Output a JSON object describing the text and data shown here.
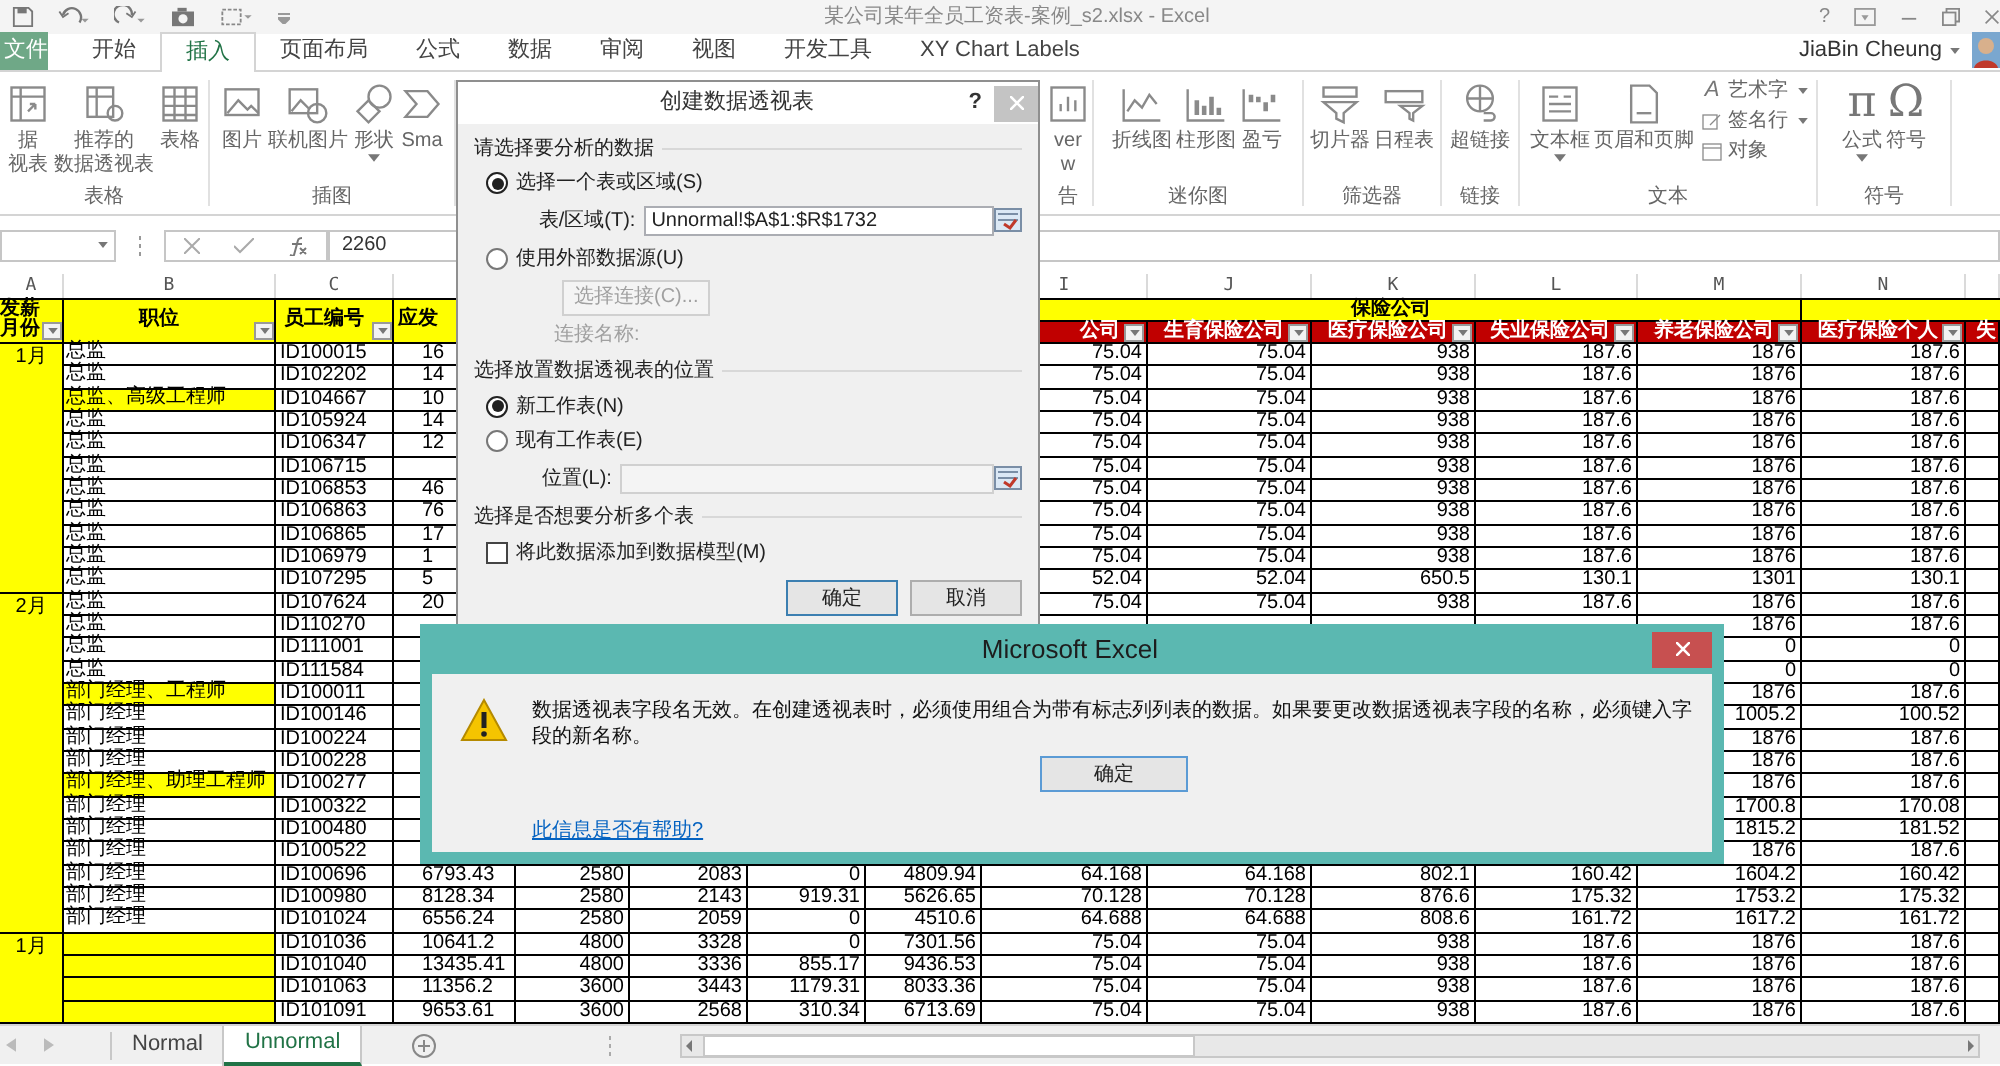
{
  "title_bar": {
    "title": "某公司某年全员工资表-案例_s2.xlsx - Excel",
    "help": "?"
  },
  "tabs": [
    {
      "label": "文件",
      "kind": "file",
      "selected": false
    },
    {
      "label": "开始",
      "kind": "tab",
      "selected": false
    },
    {
      "label": "插入",
      "kind": "tab",
      "selected": true
    },
    {
      "label": "页面布局",
      "kind": "tab",
      "selected": false
    },
    {
      "label": "公式",
      "kind": "tab",
      "selected": false
    },
    {
      "label": "数据",
      "kind": "tab",
      "selected": false
    },
    {
      "label": "审阅",
      "kind": "tab",
      "selected": false
    },
    {
      "label": "视图",
      "kind": "tab",
      "selected": false
    },
    {
      "label": "开发工具",
      "kind": "tab",
      "selected": false
    },
    {
      "label": "XY Chart Labels",
      "kind": "tab",
      "selected": false
    }
  ],
  "user": {
    "name": "JiaBin Cheung"
  },
  "ribbon": {
    "groups": [
      {
        "label": "表格",
        "items": [
          {
            "lines": [
              "据",
              "视表"
            ],
            "dropdown": false
          },
          {
            "lines": [
              "推荐的",
              "数据透视表"
            ],
            "dropdown": false
          },
          {
            "lines": [
              "表格"
            ],
            "dropdown": false
          }
        ]
      },
      {
        "label": "插图",
        "items": [
          {
            "lines": [
              "图片"
            ],
            "dropdown": false
          },
          {
            "lines": [
              "联机图片"
            ],
            "dropdown": false
          },
          {
            "lines": [
              "形状"
            ],
            "dropdown": true
          },
          {
            "lines": [
              "Sma"
            ],
            "dropdown": false
          }
        ]
      },
      {
        "label": "告",
        "items": [
          {
            "lines": [
              "ver",
              "w"
            ],
            "dropdown": false
          }
        ]
      },
      {
        "label": "迷你图",
        "items": [
          {
            "lines": [
              "折线图"
            ],
            "dropdown": false
          },
          {
            "lines": [
              "柱形图"
            ],
            "dropdown": false
          },
          {
            "lines": [
              "盈亏"
            ],
            "dropdown": false
          }
        ]
      },
      {
        "label": "筛选器",
        "items": [
          {
            "lines": [
              "切片器"
            ],
            "dropdown": false
          },
          {
            "lines": [
              "日程表"
            ],
            "dropdown": false
          }
        ]
      },
      {
        "label": "链接",
        "items": [
          {
            "lines": [
              "超链接"
            ],
            "dropdown": false
          }
        ]
      },
      {
        "label": "文本",
        "items": [
          {
            "lines": [
              "文本框"
            ],
            "dropdown": true
          },
          {
            "lines": [
              "页眉和页脚"
            ],
            "dropdown": false
          }
        ],
        "stack": [
          {
            "label": "艺术字",
            "glyph": "A",
            "dropdown": true
          },
          {
            "label": "签名行",
            "dropdown": true
          },
          {
            "label": "对象",
            "dropdown": false
          }
        ]
      },
      {
        "label": "符号",
        "items": [
          {
            "lines": [
              "公式"
            ],
            "glyph": "π",
            "dropdown": true
          },
          {
            "lines": [
              "符号"
            ],
            "glyph": "Ω",
            "dropdown": false
          }
        ]
      }
    ]
  },
  "formula_bar": {
    "value": "2260"
  },
  "sheet": {
    "column_letters": {
      "A": "A",
      "B": "B",
      "C": "C",
      "I": "I",
      "J": "J",
      "K": "K",
      "L": "L",
      "M": "M",
      "N": "N"
    },
    "header": {
      "cells": {
        "A": {
          "text": "发薪月份",
          "filter": true
        },
        "B": {
          "text": "职位",
          "filter": true
        },
        "C": {
          "text": "员工编号",
          "filter": true
        },
        "D": {
          "text": "应发",
          "filter": false
        }
      },
      "band": "保险公司",
      "fields": {
        "I": {
          "text": "公司",
          "filter": true
        },
        "J": {
          "text": "生育保险公司",
          "filter": true
        },
        "K": {
          "text": "医疗保险公司",
          "filter": true
        },
        "L": {
          "text": "失业保险公司",
          "filter": true
        },
        "M": {
          "text": "养老保险公司",
          "filter": true
        },
        "N": {
          "text": "医疗保险个人",
          "filter": true
        },
        "O": {
          "text": "失",
          "filter": false
        }
      }
    },
    "groups": [
      {
        "month": "1月",
        "rows": [
          {
            "id": "ID100015",
            "position": "总监",
            "highlighted": false,
            "cells": {
              "D": "16",
              "I": "75.04",
              "J": "75.04",
              "K": "938",
              "L": "187.6",
              "M": "1876",
              "N": "187.6"
            }
          },
          {
            "id": "ID102202",
            "position": "总监",
            "highlighted": false,
            "cells": {
              "D": "14",
              "I": "75.04",
              "J": "75.04",
              "K": "938",
              "L": "187.6",
              "M": "1876",
              "N": "187.6"
            }
          },
          {
            "id": "ID104667",
            "position": "总监、高级工程师",
            "highlighted": true,
            "cells": {
              "D": "10",
              "I": "75.04",
              "J": "75.04",
              "K": "938",
              "L": "187.6",
              "M": "1876",
              "N": "187.6"
            }
          },
          {
            "id": "ID105924",
            "position": "总监",
            "highlighted": false,
            "cells": {
              "D": "14",
              "I": "75.04",
              "J": "75.04",
              "K": "938",
              "L": "187.6",
              "M": "1876",
              "N": "187.6"
            }
          },
          {
            "id": "ID106347",
            "position": "总监",
            "highlighted": false,
            "cells": {
              "D": "12",
              "I": "75.04",
              "J": "75.04",
              "K": "938",
              "L": "187.6",
              "M": "1876",
              "N": "187.6"
            }
          },
          {
            "id": "ID106715",
            "position": "总监",
            "highlighted": false,
            "cells": {
              "I": "75.04",
              "J": "75.04",
              "K": "938",
              "L": "187.6",
              "M": "1876",
              "N": "187.6"
            }
          },
          {
            "id": "ID106853",
            "position": "总监",
            "highlighted": false,
            "cells": {
              "D": "46",
              "I": "75.04",
              "J": "75.04",
              "K": "938",
              "L": "187.6",
              "M": "1876",
              "N": "187.6"
            }
          },
          {
            "id": "ID106863",
            "position": "总监",
            "highlighted": false,
            "cells": {
              "D": "76",
              "I": "75.04",
              "J": "75.04",
              "K": "938",
              "L": "187.6",
              "M": "1876",
              "N": "187.6"
            }
          },
          {
            "id": "ID106865",
            "position": "总监",
            "highlighted": false,
            "cells": {
              "D": "17",
              "I": "75.04",
              "J": "75.04",
              "K": "938",
              "L": "187.6",
              "M": "1876",
              "N": "187.6"
            }
          },
          {
            "id": "ID106979",
            "position": "总监",
            "highlighted": false,
            "cells": {
              "D": "1",
              "I": "75.04",
              "J": "75.04",
              "K": "938",
              "L": "187.6",
              "M": "1876",
              "N": "187.6"
            }
          },
          {
            "id": "ID107295",
            "position": "总监",
            "highlighted": false,
            "cells": {
              "D": "5",
              "I": "52.04",
              "J": "52.04",
              "K": "650.5",
              "L": "130.1",
              "M": "1301",
              "N": "130.1"
            }
          }
        ]
      },
      {
        "month": "2月",
        "rows": [
          {
            "id": "ID107624",
            "position": "总监",
            "highlighted": false,
            "cells": {
              "D": "20",
              "I": "75.04",
              "J": "75.04",
              "K": "938",
              "L": "187.6",
              "M": "1876",
              "N": "187.6"
            }
          },
          {
            "id": "ID110270",
            "position": "总监",
            "highlighted": false,
            "cells": {
              "M": "1876",
              "N": "187.6"
            }
          },
          {
            "id": "ID111001",
            "position": "总监",
            "highlighted": false,
            "cells": {
              "M": "0",
              "N": "0"
            }
          },
          {
            "id": "ID111584",
            "position": "总监",
            "highlighted": false,
            "cells": {
              "M": "0",
              "N": "0"
            }
          },
          {
            "id": "ID100011",
            "position": "部门经理、工程师",
            "highlighted": true,
            "cells": {
              "M": "1876",
              "N": "187.6"
            }
          },
          {
            "id": "ID100146",
            "position": "部门经理",
            "highlighted": false,
            "cells": {
              "M": "1005.2",
              "N": "100.52"
            }
          },
          {
            "id": "ID100224",
            "position": "部门经理",
            "highlighted": false,
            "cells": {
              "M": "1876",
              "N": "187.6"
            }
          },
          {
            "id": "ID100228",
            "position": "部门经理",
            "highlighted": false,
            "cells": {
              "M": "1876",
              "N": "187.6"
            }
          },
          {
            "id": "ID100277",
            "position": "部门经理、助理工程师",
            "highlighted": true,
            "cells": {
              "M": "1876",
              "N": "187.6"
            }
          },
          {
            "id": "ID100322",
            "position": "部门经理",
            "highlighted": false,
            "cells": {
              "M": "1700.8",
              "N": "170.08"
            }
          },
          {
            "id": "ID100480",
            "position": "部门经理",
            "highlighted": false,
            "cells": {
              "M": "1815.2",
              "N": "181.52"
            }
          },
          {
            "id": "ID100522",
            "position": "部门经理",
            "highlighted": false,
            "cells": {
              "M": "1876",
              "N": "187.6"
            }
          },
          {
            "id": "ID100696",
            "position": "部门经理",
            "highlighted": false,
            "cells": {
              "D": "6793.43",
              "E": "2580",
              "F": "2083",
              "G": "0",
              "H": "4809.94",
              "I": "64.168",
              "J": "64.168",
              "K": "802.1",
              "L": "160.42",
              "M": "1604.2",
              "N": "160.42"
            }
          },
          {
            "id": "ID100980",
            "position": "部门经理",
            "highlighted": false,
            "cells": {
              "D": "8128.34",
              "E": "2580",
              "F": "2143",
              "G": "919.31",
              "H": "5626.65",
              "I": "70.128",
              "J": "70.128",
              "K": "876.6",
              "L": "175.32",
              "M": "1753.2",
              "N": "175.32"
            }
          },
          {
            "id": "ID101024",
            "position": "部门经理",
            "highlighted": false,
            "cells": {
              "D": "6556.24",
              "E": "2580",
              "F": "2059",
              "G": "0",
              "H": "4510.6",
              "I": "64.688",
              "J": "64.688",
              "K": "808.6",
              "L": "161.72",
              "M": "1617.2",
              "N": "161.72"
            }
          }
        ]
      },
      {
        "month": "1月",
        "rows": [
          {
            "id": "ID101036",
            "highlighted": true,
            "cells": {
              "D": "10641.2",
              "E": "4800",
              "F": "3328",
              "G": "0",
              "H": "7301.56",
              "I": "75.04",
              "J": "75.04",
              "K": "938",
              "L": "187.6",
              "M": "1876",
              "N": "187.6"
            }
          },
          {
            "id": "ID101040",
            "highlighted": true,
            "cells": {
              "D": "13435.41",
              "E": "4800",
              "F": "3336",
              "G": "855.17",
              "H": "9436.53",
              "I": "75.04",
              "J": "75.04",
              "K": "938",
              "L": "187.6",
              "M": "1876",
              "N": "187.6"
            }
          },
          {
            "id": "ID101063",
            "highlighted": true,
            "cells": {
              "D": "11356.2",
              "E": "3600",
              "F": "3443",
              "G": "1179.31",
              "H": "8033.36",
              "I": "75.04",
              "J": "75.04",
              "K": "938",
              "L": "187.6",
              "M": "1876",
              "N": "187.6"
            }
          },
          {
            "id": "ID101091",
            "highlighted": true,
            "cells": {
              "D": "9653.61",
              "E": "3600",
              "F": "2568",
              "G": "310.34",
              "H": "6713.69",
              "I": "75.04",
              "J": "75.04",
              "K": "938",
              "L": "187.6",
              "M": "1876",
              "N": "187.6"
            }
          }
        ]
      }
    ]
  },
  "sheet_tabs": [
    {
      "label": "Normal",
      "selected": false
    },
    {
      "label": "Unnormal",
      "selected": true
    }
  ],
  "pivot_dialog": {
    "title": "创建数据透视表",
    "help": "?",
    "source_heading": "请选择要分析的数据",
    "source_options": [
      {
        "label": "选择一个表或区域(S)",
        "selected": true
      },
      {
        "label": "使用外部数据源(U)",
        "selected": false
      }
    ],
    "range_label": "表/区域(T):",
    "range_value": "Unnormal!$A$1:$R$1732",
    "connection_button": {
      "label": "选择连接(C)...",
      "disabled": true
    },
    "connection_name": {
      "label": "连接名称:",
      "disabled": true
    },
    "location_heading": "选择放置数据透视表的位置",
    "location_options": [
      {
        "label": "新工作表(N)",
        "selected": true
      },
      {
        "label": "现有工作表(E)",
        "selected": false
      }
    ],
    "location_field": {
      "label": "位置(L):",
      "disabled": true
    },
    "model_heading": "选择是否想要分析多个表",
    "model_checkbox": {
      "label": "将此数据添加到数据模型(M)",
      "checked": false
    },
    "buttons": [
      {
        "label": "确定",
        "default": true
      },
      {
        "label": "取消",
        "default": false
      }
    ]
  },
  "error_dialog": {
    "title": "Microsoft Excel",
    "message": "数据透视表字段名无效。在创建透视表时，必须使用组合为带有标志列列表的数据。如果要更改数据透视表字段的名称，必须键入字段的新名称。",
    "button": "确定",
    "help_link": "此信息是否有帮助?"
  }
}
